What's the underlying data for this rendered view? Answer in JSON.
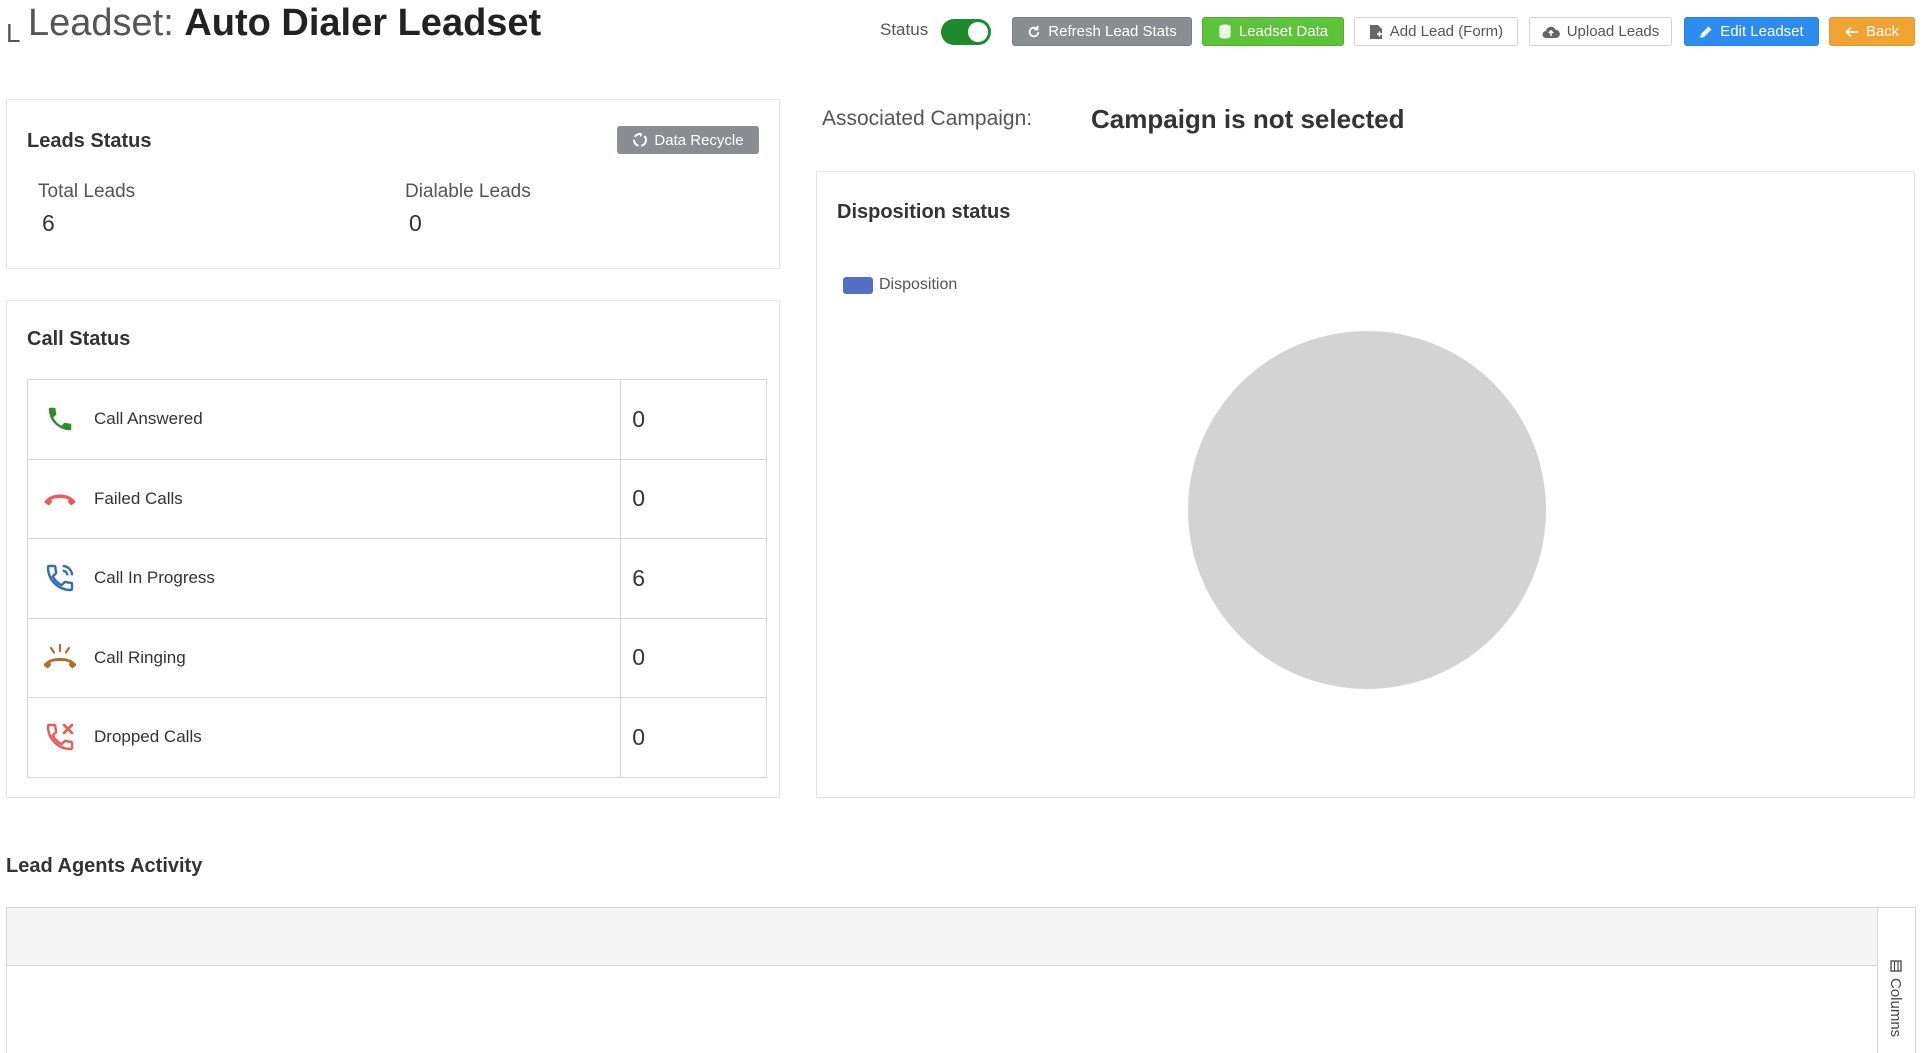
{
  "header": {
    "prefix_letter": "L",
    "title_prefix": "Leadset: ",
    "title_name": "Auto Dialer Leadset",
    "status_label": "Status",
    "status_on": true
  },
  "toolbar": {
    "refresh_label": "Refresh Lead Stats",
    "leadset_data_label": "Leadset Data",
    "add_lead_label": "Add Lead (Form)",
    "upload_label": "Upload Leads",
    "edit_label": "Edit Leadset",
    "back_label": "Back"
  },
  "leads_status": {
    "title": "Leads Status",
    "recycle_label": "Data Recycle",
    "total_label": "Total Leads",
    "total_value": "6",
    "dialable_label": "Dialable Leads",
    "dialable_value": "0"
  },
  "call_status": {
    "title": "Call Status",
    "rows": [
      {
        "label": "Call Answered",
        "value": "0",
        "icon": "phone-answered-icon",
        "color": "#2e8b2e"
      },
      {
        "label": "Failed Calls",
        "value": "0",
        "icon": "phone-hangup-icon",
        "color": "#e85b5b"
      },
      {
        "label": "Call In Progress",
        "value": "6",
        "icon": "phone-in-progress-icon",
        "color": "#2f6fb5"
      },
      {
        "label": "Call Ringing",
        "value": "0",
        "icon": "phone-ringing-icon",
        "color": "#a8722c"
      },
      {
        "label": "Dropped Calls",
        "value": "0",
        "icon": "phone-dropped-icon",
        "color": "#e85b5b"
      }
    ]
  },
  "campaign": {
    "label": "Associated Campaign:",
    "value": "Campaign is not selected"
  },
  "disposition": {
    "title": "Disposition status",
    "legend_label": "Disposition",
    "legend_color": "#5470c6",
    "empty_color": "#d3d3d3"
  },
  "agents": {
    "title": "Lead Agents Activity",
    "columns_label": "Columns"
  }
}
